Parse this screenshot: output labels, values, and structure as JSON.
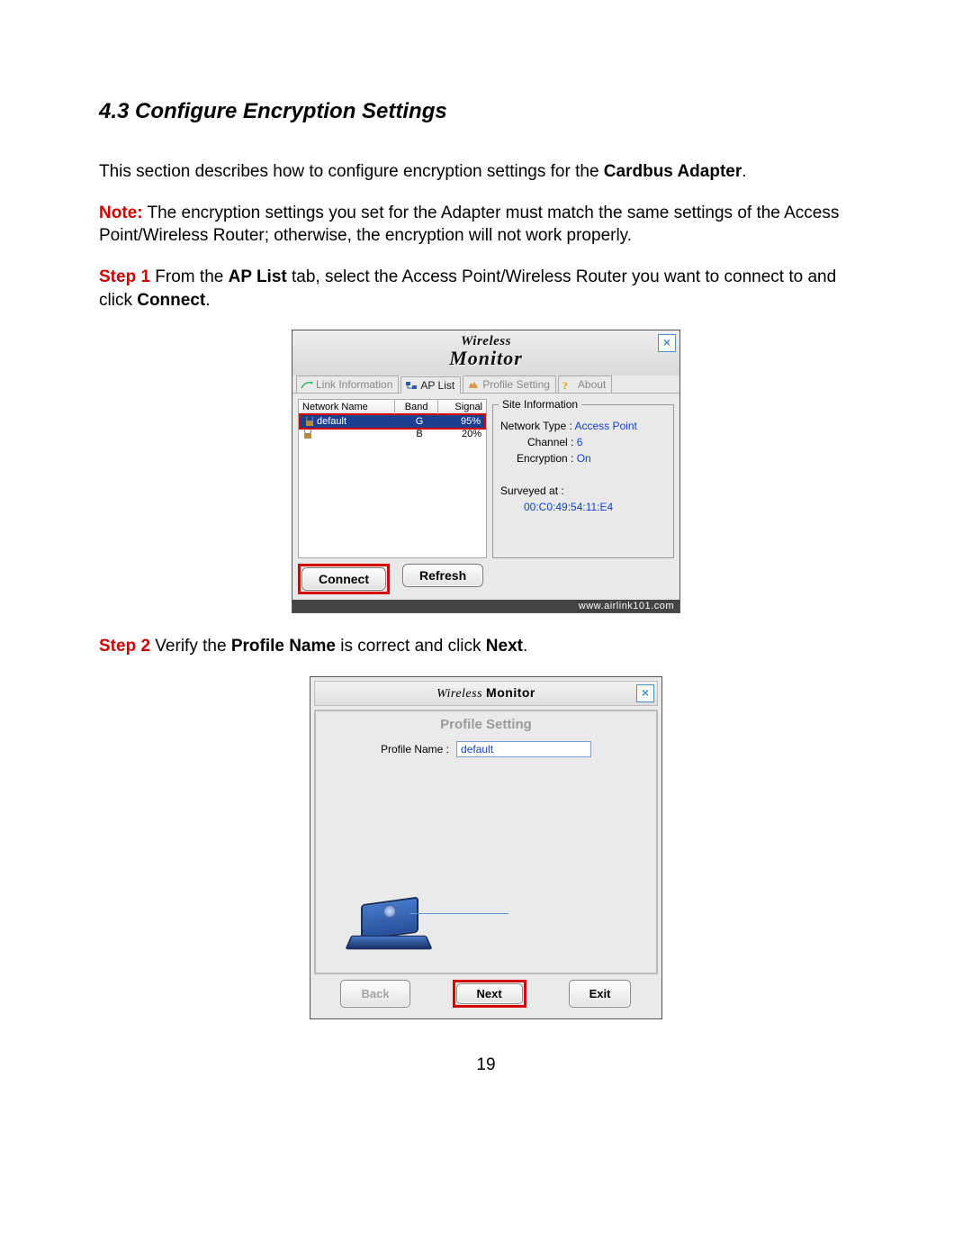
{
  "doc": {
    "heading": "4.3 Configure Encryption Settings",
    "intro_a": "This section describes how to configure encryption settings for the ",
    "intro_bold": "Cardbus Adapter",
    "intro_b": ".",
    "note_label": "Note:",
    "note_text": " The encryption settings you set for the Adapter must match the same settings of the Access Point/Wireless Router; otherwise, the encryption will not work properly.",
    "step1_label": "Step 1",
    "step1_a": " From the ",
    "step1_bold1": "AP List",
    "step1_b": " tab, select the Access Point/Wireless Router you want to connect to and click ",
    "step1_bold2": "Connect",
    "step1_c": ".",
    "step2_label": "Step 2",
    "step2_a": " Verify the ",
    "step2_bold1": "Profile Name",
    "step2_b": " is correct and click ",
    "step2_bold2": "Next",
    "step2_c": ".",
    "page_num": "19"
  },
  "shot1": {
    "logo_top": "Wireless",
    "logo_bottom": "Monitor",
    "close": "×",
    "tabs": {
      "link_info": "Link Information",
      "ap_list": "AP List",
      "profile": "Profile Setting",
      "about": "About"
    },
    "columns": {
      "c1": "Network Name",
      "c2": "Band",
      "c3": "Signal"
    },
    "rows": [
      {
        "name": "default",
        "band": "G",
        "signal": "95%"
      },
      {
        "name": "",
        "band": "B",
        "signal": "20%"
      }
    ],
    "site": {
      "legend": "Site Information",
      "nettype_k": "Network Type : ",
      "nettype_v": "Access Point",
      "channel_k": "Channel : ",
      "channel_v": "6",
      "enc_k": "Encryption : ",
      "enc_v": "On",
      "surveyed": "Surveyed at :",
      "mac": "00:C0:49:54:11:E4"
    },
    "btn_connect": "Connect",
    "btn_refresh": "Refresh",
    "footer": "www.airlink101.com"
  },
  "shot2": {
    "logo_a": "Wireless",
    "logo_b": "Monitor",
    "close": "×",
    "title": "Profile Setting",
    "label": "Profile Name :",
    "value": "default",
    "btn_back": "Back",
    "btn_next": "Next",
    "btn_exit": "Exit"
  }
}
